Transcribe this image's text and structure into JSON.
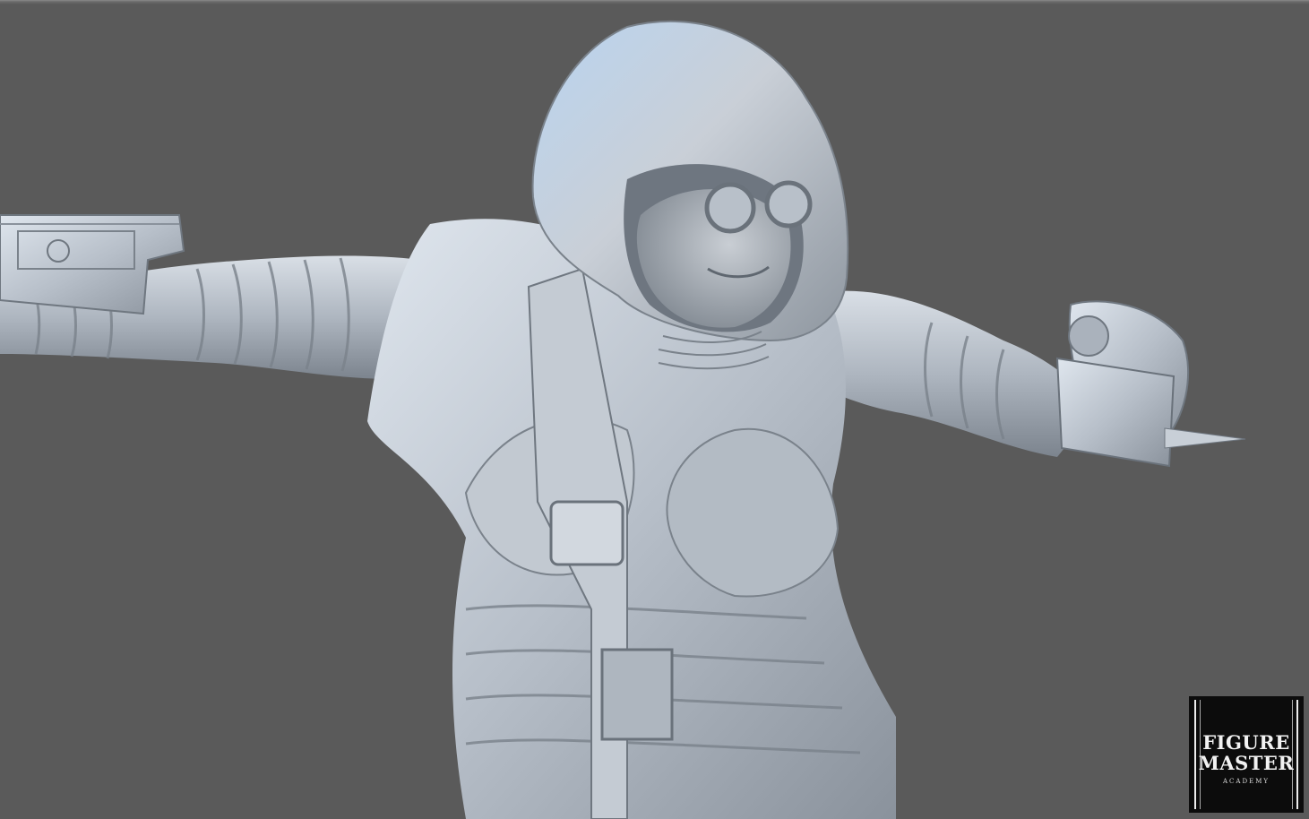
{
  "viewport": {
    "background": "#5a5a5a",
    "subject": "sculpted hooded character with goggles, arms outstretched, holding devices"
  },
  "watermark": {
    "line1": "FIGURE",
    "line2": "MASTER",
    "line3": "ACADEMY"
  },
  "colors": {
    "clay_light": "#e8edf2",
    "clay_mid": "#bfc6cf",
    "clay_dark": "#7d858f",
    "highlight_blue": "#9cc4ee",
    "badge_bg": "#0c0c0c"
  }
}
